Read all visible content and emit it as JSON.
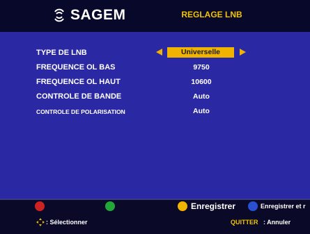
{
  "header": {
    "brand": "SAGEM",
    "title": "REGLAGE LNB"
  },
  "settings": [
    {
      "label": "TYPE DE LNB",
      "value": "Universelle",
      "selected": true
    },
    {
      "label": "FREQUENCE OL BAS",
      "value": "9750"
    },
    {
      "label": "FREQUENCE OL HAUT",
      "value": "10600"
    },
    {
      "label": "CONTROLE DE BANDE",
      "value": "Auto"
    },
    {
      "label": "CONTROLE DE POLARISATION",
      "value": "Auto"
    }
  ],
  "footer": {
    "yellow_label": "Enregistrer",
    "blue_label": "Enregistrer et r",
    "select_label": ": Sélectionner",
    "quit_key": "QUITTER",
    "quit_label": ": Annuler"
  },
  "colors": {
    "accent": "#f0b400",
    "background": "#2a29a3",
    "red_button": "#cc2222",
    "green_button": "#22a63a",
    "yellow_button": "#f0b400",
    "blue_button": "#2a4fd0"
  },
  "icons": {
    "logo": "sagem-logo-icon",
    "left_arrow": "left-arrow-icon",
    "right_arrow": "right-arrow-icon",
    "navigation": "navigation-cross-icon"
  }
}
